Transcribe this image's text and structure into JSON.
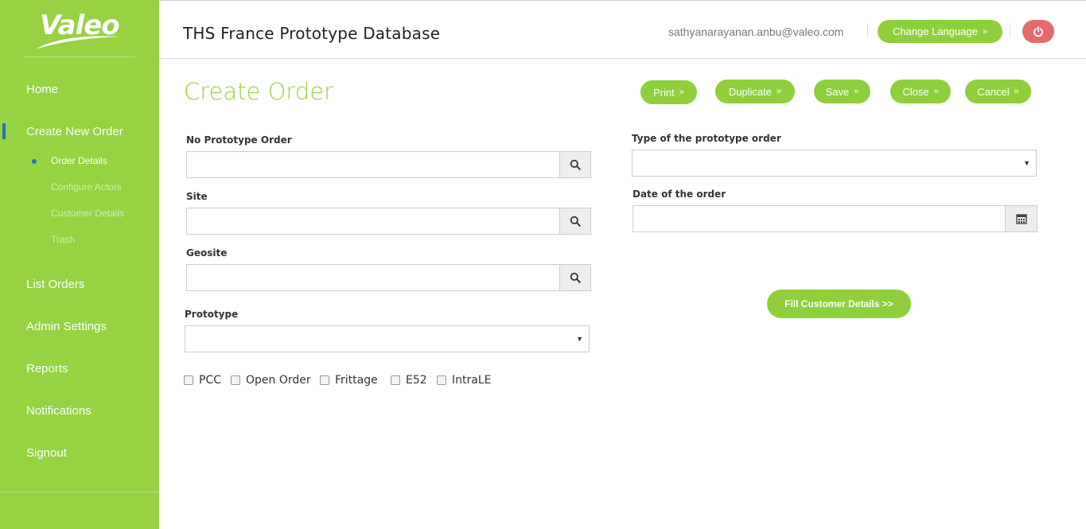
{
  "brand": {
    "logo_text": "Valeo",
    "accent": "#96d242",
    "accent_dark": "#8fcf3c",
    "danger": "#e56a6a",
    "indicator": "#2a6fc4"
  },
  "sidebar": {
    "items": [
      {
        "label": "Home"
      },
      {
        "label": "Create New Order",
        "active": true
      },
      {
        "label": "List Orders"
      },
      {
        "label": "Admin Settings"
      },
      {
        "label": "Reports"
      },
      {
        "label": "Notifications"
      },
      {
        "label": "Signout"
      }
    ],
    "sub_items": [
      {
        "label": "Order Details",
        "active": true
      },
      {
        "label": "Configure Actors"
      },
      {
        "label": "Customer Details"
      },
      {
        "label": "Trash"
      }
    ]
  },
  "header": {
    "title": "THS France Prototype Database",
    "user_email": "sathyanarayanan.anbu@valeo.com",
    "language_button": "Change Language",
    "power_icon": "power-icon"
  },
  "page": {
    "title": "Create Order",
    "actions": [
      "Print",
      "Duplicate",
      "Save",
      "Close",
      "Cancel"
    ]
  },
  "form": {
    "no_prototype_order": {
      "label": "No Prototype Order",
      "value": ""
    },
    "site": {
      "label": "Site",
      "value": ""
    },
    "geosite": {
      "label": "Geosite",
      "value": ""
    },
    "prototype": {
      "label": "Prototype",
      "value": ""
    },
    "type_of_order": {
      "label": "Type of the prototype order",
      "value": ""
    },
    "date_of_order": {
      "label": "Date of the order",
      "value": ""
    },
    "checkboxes": [
      {
        "label": "PCC",
        "checked": false
      },
      {
        "label": "Open Order",
        "checked": false
      },
      {
        "label": "Frittage",
        "checked": false
      },
      {
        "label": "E52",
        "checked": false
      },
      {
        "label": "IntraLE",
        "checked": false
      }
    ],
    "fill_customer_button": "Fill Customer Details >>"
  }
}
